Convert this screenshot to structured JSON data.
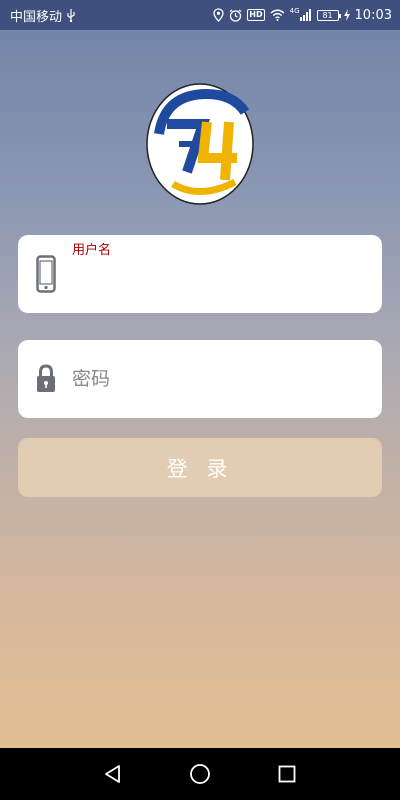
{
  "status_bar": {
    "carrier": "中国移动",
    "usb_icon": "usb-icon",
    "hd": "HD",
    "network": "4G",
    "battery": "81",
    "time": "10:03"
  },
  "logo": {
    "icon": "company-logo"
  },
  "login_form": {
    "username_label": "用户名",
    "username_value": "",
    "password_placeholder": "密码",
    "login_button": "登 录"
  },
  "colors": {
    "status_bar_bg": "#3f4f7e",
    "label_red": "#b00000",
    "button_bg": "#e2cdb2",
    "logo_blue": "#1f4aa0",
    "logo_yellow": "#f0b400"
  },
  "nav": {
    "back_icon": "back-triangle-icon",
    "home_icon": "home-circle-icon",
    "recent_icon": "recent-square-icon"
  }
}
